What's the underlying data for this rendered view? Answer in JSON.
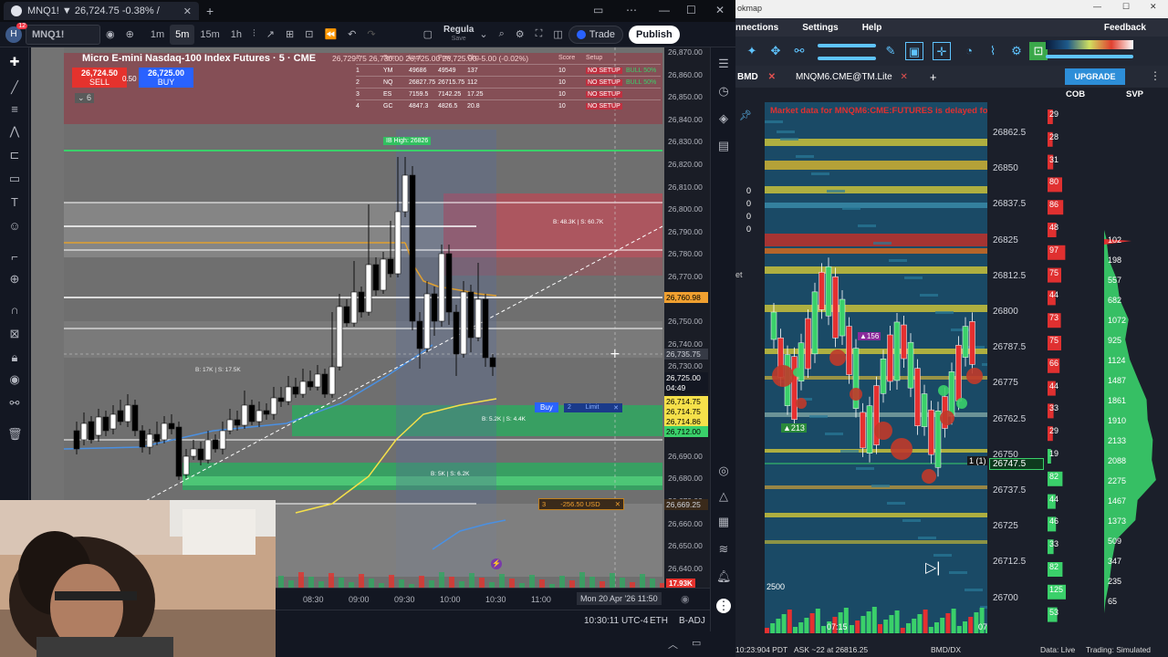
{
  "tv": {
    "tab_title": "MNQ1! ▼ 26,724.75 -0.38% /",
    "symbol": "MNQ1!",
    "user_initial": "H",
    "notif_count": "12",
    "intervals": [
      "1m",
      "5m",
      "15m",
      "1h"
    ],
    "layout_name": "Regula",
    "layout_sub": "Save",
    "trade_label": "Trade",
    "publish_label": "Publish",
    "chart_title": "Micro E-mini Nasdaq-100 Index Futures · 5 · CME",
    "ohlc": "26,729.75 26,730.00 26,725.00 26,725.00 -5.00 (-0.02%)",
    "sell_price": "26,724.50",
    "sell_label": "SELL",
    "spread": "0.50",
    "buy_price": "26,725.00",
    "buy_label": "BUY",
    "indicator_count": "6",
    "table": {
      "headers": [
        "#",
        "Sym",
        "Last",
        "Prev",
        "Chg",
        "Score",
        "Setup"
      ],
      "rows": [
        [
          "1",
          "YM",
          "49686",
          "49549",
          "137",
          "10",
          "NO SETUP"
        ],
        [
          "2",
          "NQ",
          "26827.75",
          "26715.75",
          "112",
          "10",
          "NO SETUP"
        ],
        [
          "3",
          "ES",
          "7159.5",
          "7142.25",
          "17.25",
          "10",
          "NO SETUP"
        ],
        [
          "4",
          "GC",
          "4847.3",
          "4826.5",
          "20.8",
          "10",
          "NO SETUP"
        ]
      ],
      "bull_tags": [
        "BULL 50%",
        "BULL 50%"
      ]
    },
    "ib_high": "IB High: 26826",
    "zone_labels": [
      "B: 48.3K | S: 60.7K",
      "B: 17K | S: 17.5K",
      "B: 5.2K | S: 4.4K",
      "B: 5K | S: 6.2K"
    ],
    "buy_order_label": "Buy",
    "limit_label": "Limit",
    "position_qty": "3",
    "position_pnl": "-256.50 USD",
    "volume_label": "17.93K",
    "price_axis": [
      "26,870.00",
      "26,860.00",
      "26,850.00",
      "26,840.00",
      "26,830.00",
      "26,820.00",
      "26,810.00",
      "26,800.00",
      "26,790.00",
      "26,780.00",
      "26,770.00",
      "26,760.00",
      "26,750.00",
      "26,740.00",
      "26,730.00",
      "26,720.00",
      "26,710.00",
      "26,700.00",
      "26,690.00",
      "26,680.00",
      "26,670.00",
      "26,660.00",
      "26,650.00",
      "26,640.00"
    ],
    "price_tags": {
      "orange": "26,760.98",
      "crosshair": "26,735.75",
      "last": "26,725.00",
      "countdown": "04:49",
      "yellow1": "26,714.75",
      "yellow2": "26,714.75",
      "yellow3": "26,714.86",
      "green": "26,712.00",
      "brown": "26,669.25"
    },
    "time_axis": [
      "08:30",
      "09:00",
      "09:30",
      "10:00",
      "10:30",
      "11:00"
    ],
    "time_cursor": "Mon 20 Apr '26   11:50",
    "status_time": "10:30:11 UTC-4",
    "status_session": "ETH",
    "status_adj": "B-ADJ"
  },
  "bm": {
    "title_fragment": "okmap",
    "menu": [
      "nnections",
      "Settings",
      "Help"
    ],
    "feedback": "Feedback",
    "tabs": [
      "BMD",
      "MNQM6.CME@TM.Lite"
    ],
    "upgrade_label": "UPGRADE",
    "col_cob": "COB",
    "col_svp": "SVP",
    "delay_notice": "Market data for MNQM6:CME:FUTURES is delayed for 15 minut",
    "prices": [
      "26862.5",
      "26850",
      "26837.5",
      "26825",
      "26812.5",
      "26800",
      "26787.5",
      "26775",
      "26762.5",
      "26750",
      "26737.5",
      "26725",
      "26712.5",
      "26700"
    ],
    "current_price": "26747.5",
    "cob_values": [
      "29",
      "28",
      "31",
      "80",
      "86",
      "48",
      "97",
      "75",
      "44",
      "73",
      "75",
      "66",
      "44",
      "33",
      "29",
      "19",
      "82",
      "44",
      "46",
      "33",
      "82",
      "125",
      "53"
    ],
    "svp_values": [
      "102",
      "198",
      "557",
      "682",
      "1072",
      "925",
      "1124",
      "1487",
      "1861",
      "1910",
      "2133",
      "2088",
      "2275",
      "1467",
      "1373",
      "509",
      "347",
      "235",
      "65"
    ],
    "left_zeros": [
      "0",
      "0",
      "0",
      "0"
    ],
    "left_label": "et",
    "bubble_label": "213",
    "bubble_label2": "156",
    "order_marker": "1 (1)",
    "volume_label": "2500",
    "time_label": "07:15",
    "time_label2": "07:",
    "status_time": "10:23:904 PDT",
    "status_ask": "ASK ~22 at 26816.25",
    "status_instrument": "BMD/DX",
    "status_data": "Data: Live",
    "status_trading": "Trading: Simulated"
  }
}
